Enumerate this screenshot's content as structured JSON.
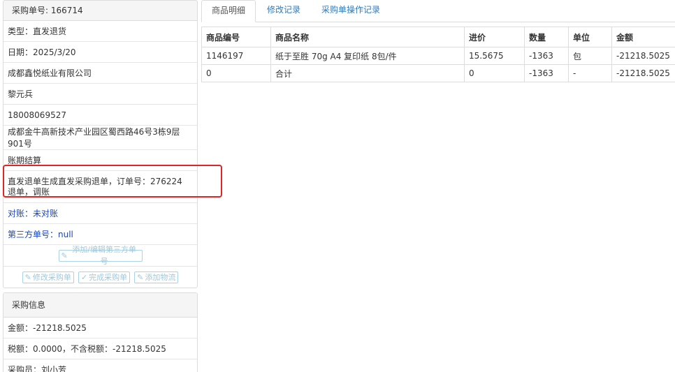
{
  "order_info": {
    "header": "采购单号: 166714",
    "type": "类型：直发退货",
    "date": "日期：2025/3/20",
    "supplier": "成都鑫悦纸业有限公司",
    "contact": "黎元兵",
    "phone": "18008069527",
    "address": "成都金牛高新技术产业园区蜀西路46号3栋9层901号",
    "payment": "账期结算",
    "note": "直发退单生成直发采购退单，订单号：276224 退单，调账",
    "reconcile": "对账：未对账",
    "third_party_no": "第三方单号：null",
    "add_third_party_btn": "添加/编辑第三方单号",
    "modify_btn": "修改采购单",
    "complete_btn": "完成采购单",
    "add_logistics_btn": "添加物流"
  },
  "purchase_info": {
    "header": "采购信息",
    "amount": "金额：-21218.5025",
    "tax": "税额：0.0000，不含税额：-21218.5025",
    "buyer": "采购员：刘小芳"
  },
  "tabs": [
    "商品明细",
    "修改记录",
    "采购单操作记录"
  ],
  "table": {
    "columns": [
      "商品编号",
      "商品名称",
      "进价",
      "数量",
      "单位",
      "金额"
    ],
    "rows": [
      [
        "1146197",
        "纸于至胜 70g A4 复印纸 8包/件",
        "15.5675",
        "-1363",
        "包",
        "-21218.5025"
      ],
      [
        "0",
        "合计",
        "0",
        "-1363",
        "-",
        "-21218.5025"
      ]
    ]
  }
}
